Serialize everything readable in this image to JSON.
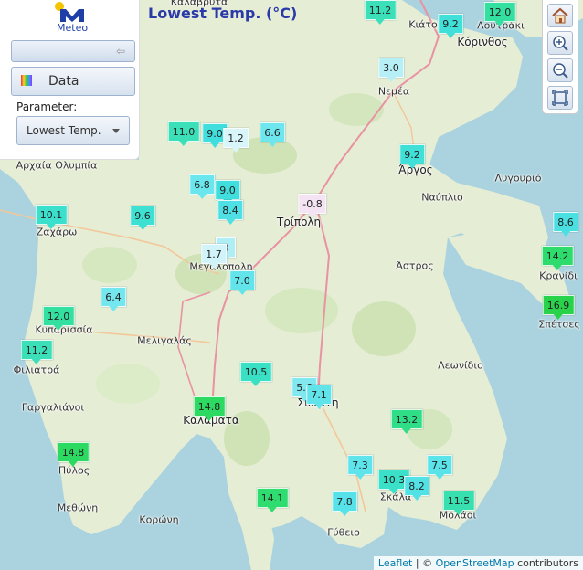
{
  "title": "Lowest Temp. (°C)",
  "app": {
    "logo_text": "Meteo"
  },
  "panel": {
    "data_label": "Data",
    "parameter_label": "Parameter:",
    "parameter_value": "Lowest Temp."
  },
  "toolbar": {
    "home": "home-icon",
    "zoom_in": "zoom-in-icon",
    "zoom_out": "zoom-out-icon",
    "fullscreen": "fullscreen-icon"
  },
  "attribution": {
    "leaflet": "Leaflet",
    "sep": " | © ",
    "osm": "OpenStreetMap",
    "tail": " contributors"
  },
  "places": [
    {
      "name": "Κιάτο"
    },
    {
      "name": "Λουτράκι"
    },
    {
      "name": "Κόρινθος"
    },
    {
      "name": "Νεμέα"
    },
    {
      "name": "Αρχαία Ολυμπία"
    },
    {
      "name": "Άργος"
    },
    {
      "name": "Ναύπλιο"
    },
    {
      "name": "Λυγουριό"
    },
    {
      "name": "Τρίπολη"
    },
    {
      "name": "Ζαχάρω"
    },
    {
      "name": "Μεγαλόπολη"
    },
    {
      "name": "Άστρος"
    },
    {
      "name": "Κρανίδι"
    },
    {
      "name": "Σπέτσες"
    },
    {
      "name": "Κυπαρισσία"
    },
    {
      "name": "Μελιγαλάς"
    },
    {
      "name": "Φιλιατρά"
    },
    {
      "name": "Λεωνίδιο"
    },
    {
      "name": "Γαργαλιάνοι"
    },
    {
      "name": "Σπάρτη"
    },
    {
      "name": "Καλαμάτα"
    },
    {
      "name": "Πύλος"
    },
    {
      "name": "Σκάλα"
    },
    {
      "name": "Μεθώνη"
    },
    {
      "name": "Μολάοι"
    },
    {
      "name": "Κορώνη"
    },
    {
      "name": "Γύθειο"
    },
    {
      "name": "Καλάβρυτα"
    }
  ],
  "stations": [
    {
      "v": "11.2",
      "c": "#3ce0b8"
    },
    {
      "v": "9.2",
      "c": "#40e0d8"
    },
    {
      "v": "12.0",
      "c": "#34e0a0"
    },
    {
      "v": "3.0",
      "c": "#b6f0f6"
    },
    {
      "v": "11.0",
      "c": "#3ce0b8"
    },
    {
      "v": "9.0",
      "c": "#40dedc"
    },
    {
      "v": "1.2",
      "c": "#d8f6fa"
    },
    {
      "v": "6.6",
      "c": "#6ee6ee"
    },
    {
      "v": "9.2",
      "c": "#40e0d8"
    },
    {
      "v": "6.8",
      "c": "#6ae6ec"
    },
    {
      "v": "9.0",
      "c": "#40dedc"
    },
    {
      "v": "-0.8",
      "c": "#f3e3f3"
    },
    {
      "v": "8.4",
      "c": "#4ee0e4"
    },
    {
      "v": "10.1",
      "c": "#3ae0cc"
    },
    {
      "v": "9.6",
      "c": "#3ee0d2"
    },
    {
      "v": "8.6",
      "c": "#4ae0e2"
    },
    {
      "v": "3",
      "c": "#b0eef6"
    },
    {
      "v": "1.7",
      "c": "#d0f4fa"
    },
    {
      "v": "14.2",
      "c": "#2edc6e"
    },
    {
      "v": "7.0",
      "c": "#62e4ea"
    },
    {
      "v": "6.4",
      "c": "#74e6ee"
    },
    {
      "v": "16.9",
      "c": "#28d24a"
    },
    {
      "v": "12.0",
      "c": "#34e0a0"
    },
    {
      "v": "11.2",
      "c": "#3ce0b8"
    },
    {
      "v": "10.5",
      "c": "#3ae0c4"
    },
    {
      "v": "5.6",
      "c": "#82e8f0"
    },
    {
      "v": "7.1",
      "c": "#60e4ea"
    },
    {
      "v": "14.8",
      "c": "#2cda62"
    },
    {
      "v": "13.2",
      "c": "#30de88"
    },
    {
      "v": "14.8",
      "c": "#2cda62"
    },
    {
      "v": "7.3",
      "c": "#5ee4ea"
    },
    {
      "v": "7.5",
      "c": "#5ae4ea"
    },
    {
      "v": "10.3",
      "c": "#3ae0c8"
    },
    {
      "v": "8.2",
      "c": "#52e2e6"
    },
    {
      "v": "14.1",
      "c": "#2edc70"
    },
    {
      "v": "11.5",
      "c": "#38e0b0"
    },
    {
      "v": "7.8",
      "c": "#56e2e8"
    }
  ]
}
